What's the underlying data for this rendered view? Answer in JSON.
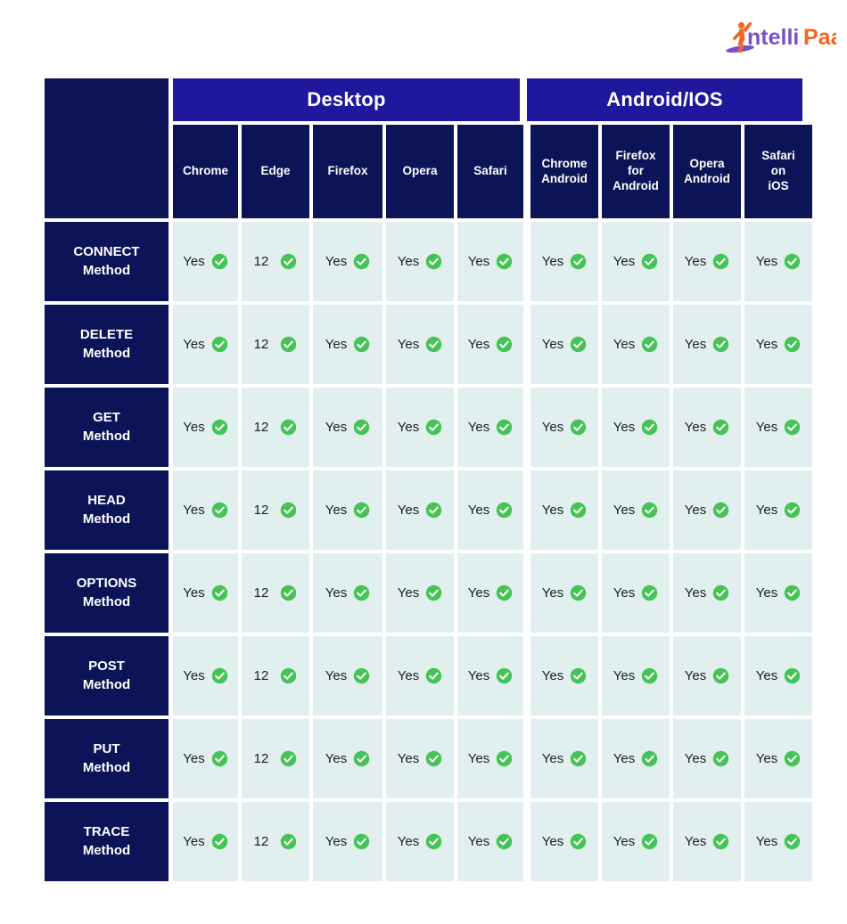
{
  "brand": {
    "logo_text_1": "ntelli",
    "logo_text_2": "Paat",
    "logo_color_primary": "#F26522",
    "logo_color_secondary": "#7B4FC9"
  },
  "table": {
    "groups": [
      {
        "name": "desktop",
        "label": "Desktop"
      },
      {
        "name": "mobile",
        "label": "Android/IOS"
      }
    ],
    "columns": [
      {
        "key": "chrome",
        "label": "Chrome",
        "group": "desktop"
      },
      {
        "key": "edge",
        "label": "Edge",
        "group": "desktop"
      },
      {
        "key": "firefox",
        "label": "Firefox",
        "group": "desktop"
      },
      {
        "key": "opera",
        "label": "Opera",
        "group": "desktop"
      },
      {
        "key": "safari",
        "label": "Safari",
        "group": "desktop"
      },
      {
        "key": "chrome_android",
        "label": "Chrome\nAndroid",
        "group": "mobile"
      },
      {
        "key": "firefox_android",
        "label": "Firefox\nfor\nAndroid",
        "group": "mobile"
      },
      {
        "key": "opera_android",
        "label": "Opera\nAndroid",
        "group": "mobile"
      },
      {
        "key": "safari_ios",
        "label": "Safari\non\niOS",
        "group": "mobile"
      }
    ],
    "rows": [
      {
        "label_line1": "CONNECT",
        "label_line2": "Method",
        "cells": [
          "Yes",
          "12",
          "Yes",
          "Yes",
          "Yes",
          "Yes",
          "Yes",
          "Yes",
          "Yes"
        ]
      },
      {
        "label_line1": "DELETE",
        "label_line2": "Method",
        "cells": [
          "Yes",
          "12",
          "Yes",
          "Yes",
          "Yes",
          "Yes",
          "Yes",
          "Yes",
          "Yes"
        ]
      },
      {
        "label_line1": "GET",
        "label_line2": "Method",
        "cells": [
          "Yes",
          "12",
          "Yes",
          "Yes",
          "Yes",
          "Yes",
          "Yes",
          "Yes",
          "Yes"
        ]
      },
      {
        "label_line1": "HEAD",
        "label_line2": "Method",
        "cells": [
          "Yes",
          "12",
          "Yes",
          "Yes",
          "Yes",
          "Yes",
          "Yes",
          "Yes",
          "Yes"
        ]
      },
      {
        "label_line1": "OPTIONS",
        "label_line2": "Method",
        "cells": [
          "Yes",
          "12",
          "Yes",
          "Yes",
          "Yes",
          "Yes",
          "Yes",
          "Yes",
          "Yes"
        ]
      },
      {
        "label_line1": "POST",
        "label_line2": "Method",
        "cells": [
          "Yes",
          "12",
          "Yes",
          "Yes",
          "Yes",
          "Yes",
          "Yes",
          "Yes",
          "Yes"
        ]
      },
      {
        "label_line1": "PUT",
        "label_line2": "Method",
        "cells": [
          "Yes",
          "12",
          "Yes",
          "Yes",
          "Yes",
          "Yes",
          "Yes",
          "Yes",
          "Yes"
        ]
      },
      {
        "label_line1": "TRACE",
        "label_line2": "Method",
        "cells": [
          "Yes",
          "12",
          "Yes",
          "Yes",
          "Yes",
          "Yes",
          "Yes",
          "Yes",
          "Yes"
        ]
      }
    ],
    "status_icon": "check-circle-icon"
  },
  "colors": {
    "band": "#1F189C",
    "header_cell": "#0D1357",
    "row_label": "#0D1357",
    "cell_bg": "#E2EFEF",
    "check_green": "#46C355",
    "page_bg": "#FFFFFF",
    "cell_text": "#1C2024"
  }
}
